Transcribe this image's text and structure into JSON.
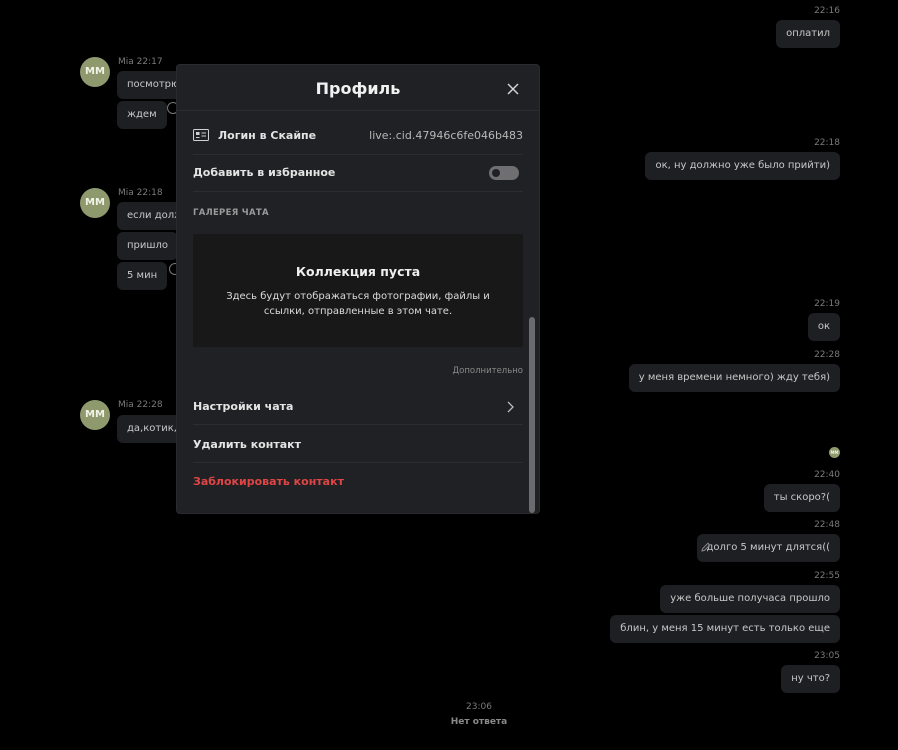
{
  "chat": {
    "left_groups": [
      {
        "avatar": "MM",
        "meta": "Mia 22:17",
        "messages": [
          "посмотрю",
          "ждем"
        ]
      },
      {
        "avatar": "MM",
        "meta": "Mia 22:18",
        "messages": [
          "если долж",
          "пришло",
          "5 мин"
        ]
      },
      {
        "avatar": "MM",
        "meta": "Mia 22:28",
        "messages": [
          "да,котик,пр"
        ]
      }
    ],
    "right_messages": [
      {
        "time": "22:16",
        "text": "оплатил"
      },
      {
        "time": "22:18",
        "text": "ок, ну должно уже было прийти)"
      },
      {
        "time": "22:19",
        "text": "ок"
      },
      {
        "time": "22:28",
        "text": "у меня времени немного) жду тебя)"
      },
      {
        "time": "22:40",
        "text": "ты скоро?("
      },
      {
        "time": "22:48",
        "text": "долго 5 минут длятся(("
      },
      {
        "time": "22:55",
        "text": "уже больше получаса прошло"
      },
      {
        "time": "",
        "text": "блин, у меня 15 минут есть только еще"
      },
      {
        "time": "23:05",
        "text": "ну что?"
      }
    ],
    "seen_avatar": "MM",
    "bottom_time": "23:06",
    "bottom_status": "Нет ответа"
  },
  "modal": {
    "title": "Профиль",
    "skype_login_label": "Логин в Скайпе",
    "skype_login_value": "live:.cid.47946c6fe046b483",
    "favorite_label": "Добавить в избранное",
    "gallery_section": "ГАЛЕРЕЯ ЧАТА",
    "gallery_empty_title": "Коллекция пуста",
    "gallery_empty_text": "Здесь будут отображаться фотографии, файлы и ссылки, отправленные в этом чате.",
    "more_link": "Дополнительно",
    "chat_settings": "Настройки чата",
    "delete_contact": "Удалить контакт",
    "block_contact": "Заблокировать контакт",
    "favorite_enabled": false
  },
  "colors": {
    "background": "#000000",
    "modal": "#202124",
    "bubble": "#1e1f23",
    "avatar": "#8e9a6e",
    "danger": "#e04545"
  }
}
